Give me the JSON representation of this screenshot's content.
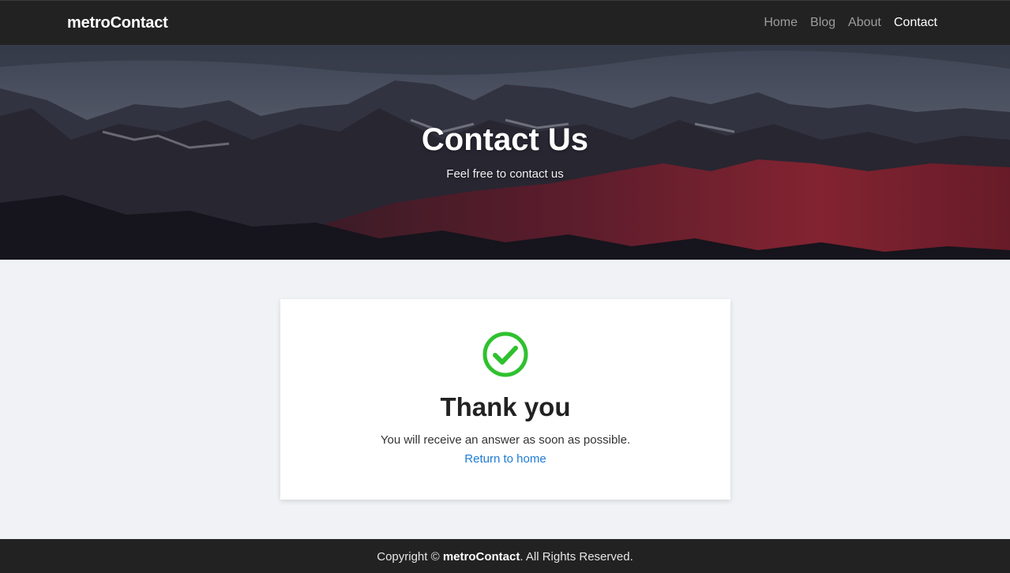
{
  "navbar": {
    "brand": "metroContact",
    "links": [
      {
        "label": "Home",
        "active": false
      },
      {
        "label": "Blog",
        "active": false
      },
      {
        "label": "About",
        "active": false
      },
      {
        "label": "Contact",
        "active": true
      }
    ]
  },
  "hero": {
    "title": "Contact Us",
    "subtitle": "Feel free to contact us"
  },
  "confirmation": {
    "icon": "check-circle-icon",
    "icon_color": "#2fc12f",
    "title": "Thank you",
    "message": "You will receive an answer as soon as possible.",
    "link_label": "Return to home"
  },
  "footer": {
    "prefix": "Copyright © ",
    "brand": "metroContact",
    "suffix": ". All Rights Reserved."
  },
  "colors": {
    "navbar_bg": "#222222",
    "page_bg": "#f0f2f6",
    "link": "#1e7bd4"
  }
}
